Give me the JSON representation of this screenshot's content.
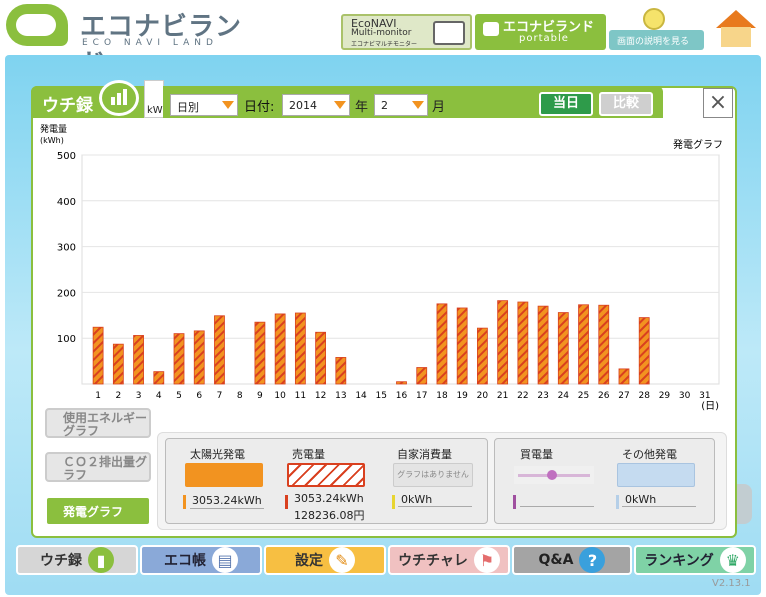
{
  "header": {
    "logo_text": "エコナビランド",
    "logo_sub": "ECO NAVI LAND",
    "econavi_title": "EcoNAVI",
    "econavi_sub": "Multi-monitor",
    "econavi_jp": "エコナビマルチモニター",
    "portable_title": "エコナビランド",
    "portable_sub": "portable",
    "help_label": "画面の説明を見る"
  },
  "window": {
    "tab_title": "ウチ録",
    "tab_unit": "kW",
    "period_select": "日別",
    "date_label": "日付:",
    "year_value": "2014",
    "year_suffix": "年",
    "month_value": "2",
    "month_suffix": "月",
    "today_button": "当日",
    "compare_button": "比較",
    "close": "×"
  },
  "side_buttons": {
    "energy": "使用エネルギーグラフ",
    "co2": "ＣＯ２排出量グラフ",
    "power": "発電グラフ"
  },
  "summary": {
    "solar_label": "太陽光発電",
    "solar_value": "3053.24kWh",
    "sold_label": "売電量",
    "sold_value": "3053.24kWh",
    "sold_yen": "128236.08円",
    "self_label": "自家消費量",
    "self_note": "グラフはありません",
    "self_value": "0kWh",
    "buy_label": "買電量",
    "other_label": "その他発電",
    "other_value": "0kWh"
  },
  "nav": {
    "items": [
      "ウチ録",
      "エコ帳",
      "設定",
      "ウチチャレ",
      "Q&A",
      "ランキング"
    ]
  },
  "version": "V2.13.1",
  "colors": {
    "accent_green": "#8bbf3e",
    "bar_orange": "#f29320",
    "bar_stripe": "#d9401f"
  },
  "chart_data": {
    "type": "bar",
    "title": "発電グラフ",
    "ylabel": "発電量 (kWh)",
    "xlabel": "(日)",
    "ylim": [
      0,
      500
    ],
    "yticks": [
      "100",
      "200",
      "300",
      "400",
      "500"
    ],
    "categories": [
      "1",
      "2",
      "3",
      "4",
      "5",
      "6",
      "7",
      "8",
      "9",
      "10",
      "11",
      "12",
      "13",
      "14",
      "15",
      "16",
      "17",
      "18",
      "19",
      "20",
      "21",
      "22",
      "23",
      "24",
      "25",
      "26",
      "27",
      "28",
      "29",
      "30",
      "31"
    ],
    "values": [
      124,
      87,
      106,
      27,
      110,
      116,
      149,
      0,
      135,
      153,
      155,
      113,
      58,
      0,
      0,
      5,
      36,
      175,
      166,
      122,
      182,
      179,
      170,
      156,
      173,
      172,
      33,
      145,
      0,
      0,
      0
    ]
  }
}
